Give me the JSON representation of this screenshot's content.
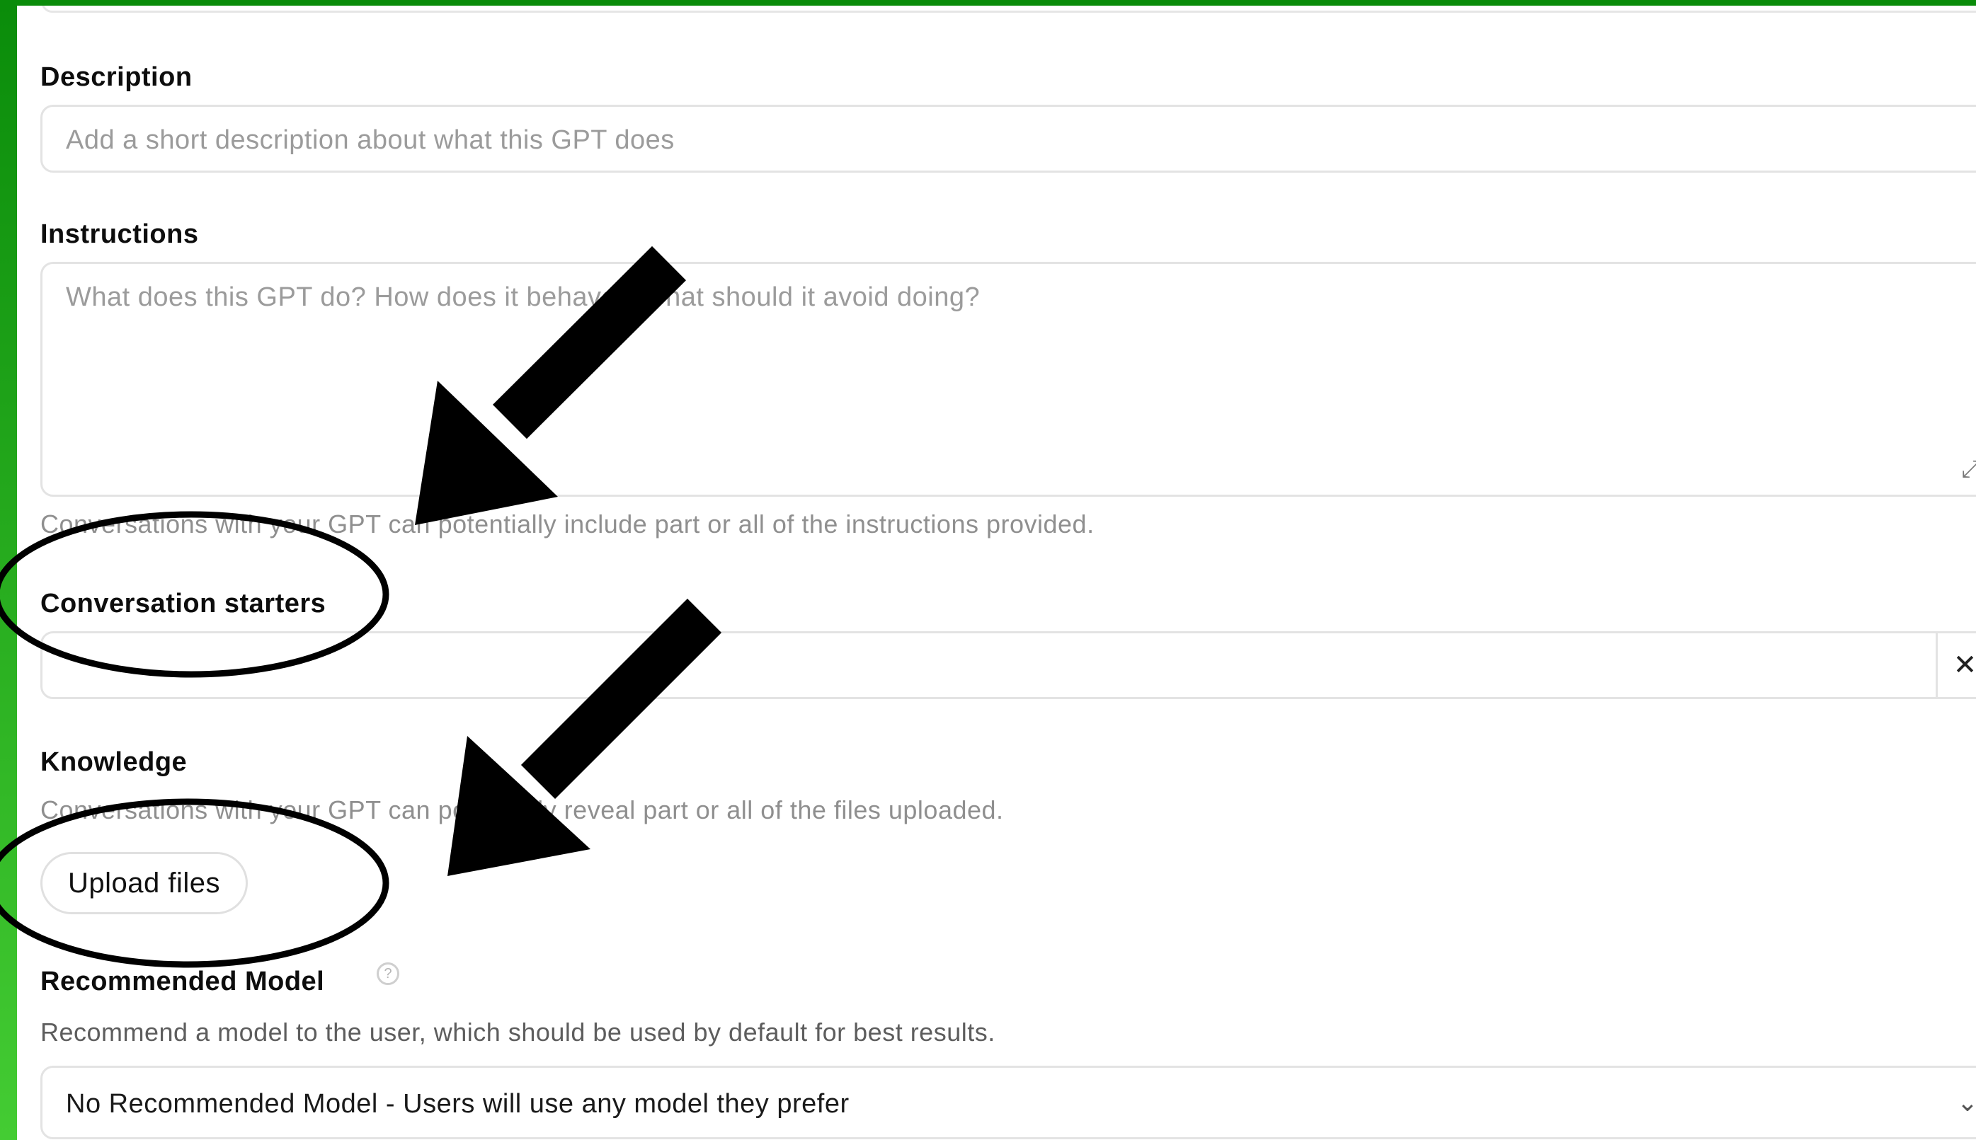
{
  "description": {
    "label": "Description",
    "placeholder": "Add a short description about what this GPT does"
  },
  "instructions": {
    "label": "Instructions",
    "placeholder": "What does this GPT do? How does it behave? What should it avoid doing?",
    "hint": "Conversations with your GPT can potentially include part or all of the instructions provided.",
    "expand_icon": "expand-icon"
  },
  "conversation_starters": {
    "label": "Conversation starters",
    "value": "",
    "remove_label": "✕"
  },
  "knowledge": {
    "label": "Knowledge",
    "hint": "Conversations with your GPT can potentially reveal part or all of the files uploaded.",
    "upload_button": "Upload files"
  },
  "recommended_model": {
    "label": "Recommended Model",
    "help_icon": "?",
    "hint": "Recommend a model to the user, which should be used by default for best results.",
    "selected": "No Recommended Model - Users will use any model they prefer"
  },
  "colors": {
    "frame_green": "#0a8c0a",
    "annotation": "#000000"
  }
}
